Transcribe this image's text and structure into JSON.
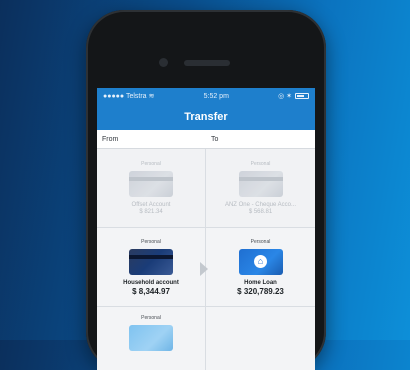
{
  "status_bar": {
    "signal": "●●●●● Telstra",
    "wifi_icon": "wifi-icon",
    "time": "5:52 pm",
    "right": "◎ ✶"
  },
  "nav": {
    "title": "Transfer"
  },
  "columns": {
    "from": "From",
    "to": "To"
  },
  "rows": [
    {
      "from": {
        "tag": "Personal",
        "name": "Offset Account",
        "balance": "$ 821.34"
      },
      "to": {
        "tag": "Personal",
        "name": "ANZ One - Cheque Acco...",
        "balance": "$ 568.81"
      }
    },
    {
      "from": {
        "tag": "Personal",
        "name": "Household account",
        "balance": "$ 8,344.97"
      },
      "to": {
        "tag": "Personal",
        "name": "Home Loan",
        "balance": "$ 320,789.23"
      }
    },
    {
      "from": {
        "tag": "Personal"
      }
    }
  ],
  "icons": {
    "transfer_arrow": "arrow-right-icon",
    "home": "home-icon"
  }
}
